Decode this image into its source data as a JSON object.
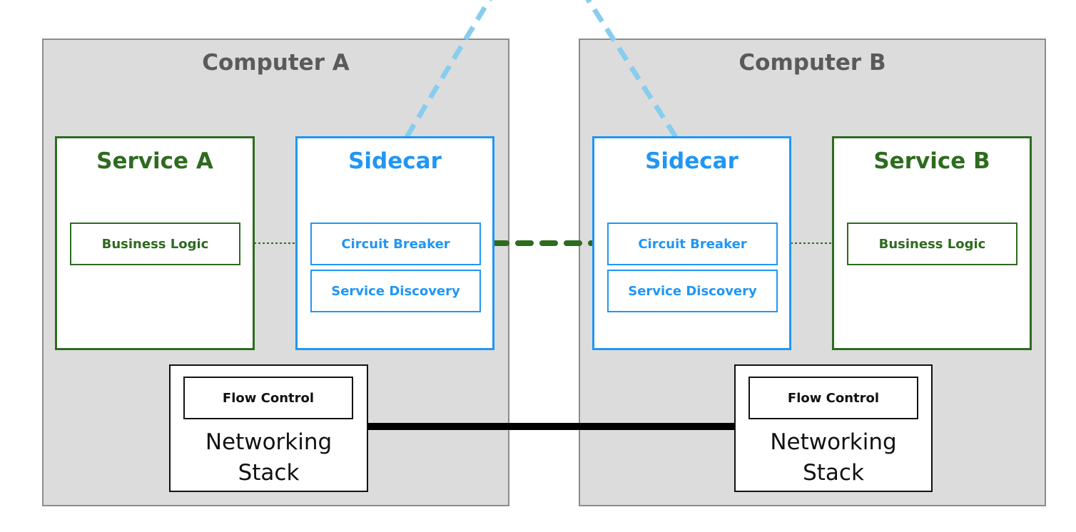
{
  "computers": [
    {
      "title": "Computer A",
      "service": {
        "title": "Service A",
        "component": "Business Logic"
      },
      "sidecar": {
        "title": "Sidecar",
        "components": [
          "Circuit Breaker",
          "Service Discovery"
        ]
      },
      "network": {
        "component": "Flow Control",
        "title_line1": "Networking",
        "title_line2": "Stack"
      }
    },
    {
      "title": "Computer B",
      "service": {
        "title": "Service B",
        "component": "Business Logic"
      },
      "sidecar": {
        "title": "Sidecar",
        "components": [
          "Circuit Breaker",
          "Service Discovery"
        ]
      },
      "network": {
        "component": "Flow Control",
        "title_line1": "Networking",
        "title_line2": "Stack"
      }
    }
  ],
  "colors": {
    "service": "#2e6b1f",
    "sidecar": "#2196f3",
    "control_plane_link": "#87cdee",
    "network_link": "#000000",
    "computer_bg": "#dcdcdc"
  }
}
